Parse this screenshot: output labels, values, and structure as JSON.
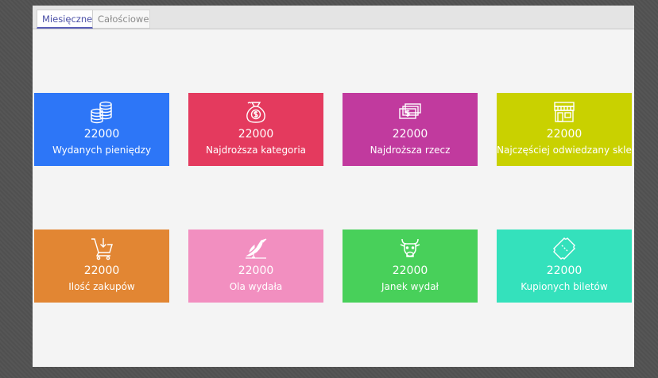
{
  "tabs": {
    "monthly": "Miesięczne",
    "total": "Całościowe"
  },
  "tiles": [
    {
      "value": "22000",
      "label": "Wydanych pieniędzy",
      "icon": "coins-stack-icon",
      "color": "#2d76f7"
    },
    {
      "value": "22000",
      "label": "Najdroższa kategoria",
      "icon": "money-bag-icon",
      "color": "#e43a5e"
    },
    {
      "value": "22000",
      "label": "Najdroższa rzecz",
      "icon": "banknotes-icon",
      "color": "#c13a9e"
    },
    {
      "value": "22000",
      "label": "Najczęściej odwiedzany sklep",
      "icon": "shop-icon",
      "color": "#c9d100"
    },
    {
      "value": "22000",
      "label": "Ilość zakupów",
      "icon": "shopping-cart-icon",
      "color": "#e28633"
    },
    {
      "value": "22000",
      "label": "Ola wydała",
      "icon": "bird-icon",
      "color": "#f28fc0"
    },
    {
      "value": "22000",
      "label": "Janek wydał",
      "icon": "bull-head-icon",
      "color": "#48d05a"
    },
    {
      "value": "22000",
      "label": "Kupionych biletów",
      "icon": "ticket-icon",
      "color": "#34e1bc"
    }
  ]
}
